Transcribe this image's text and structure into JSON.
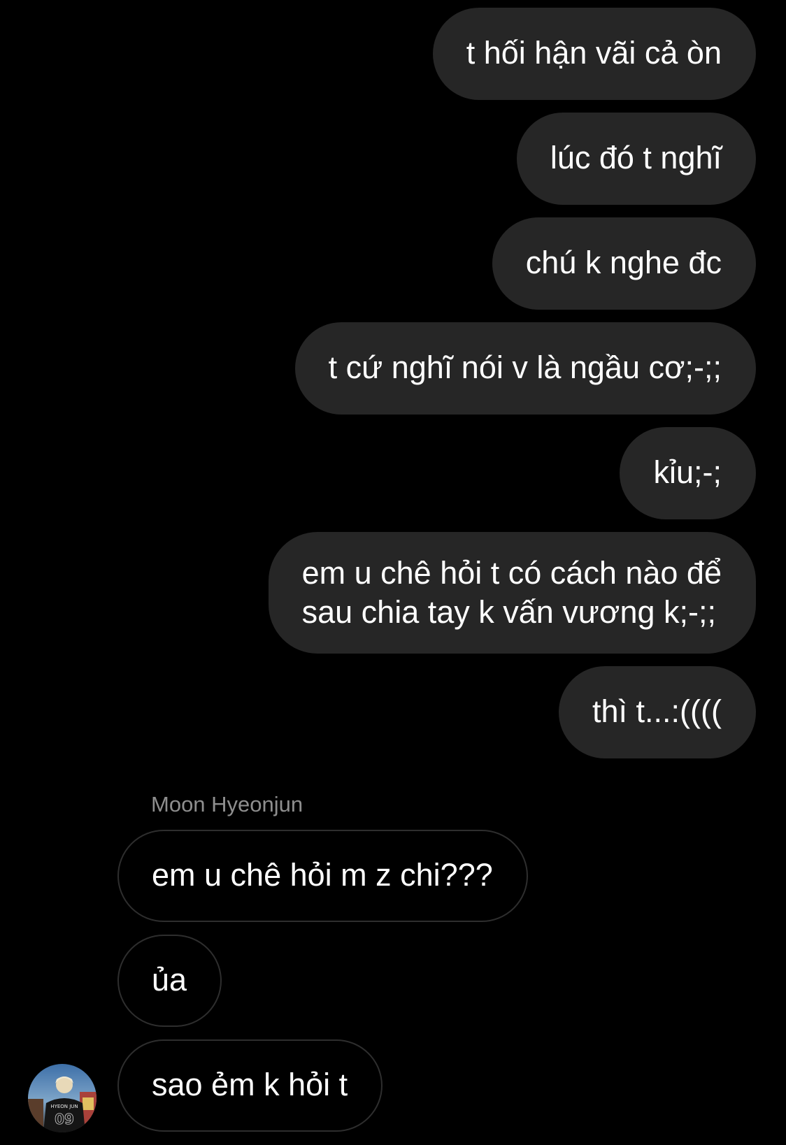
{
  "conversation": {
    "outgoing": [
      "t hối hận vãi cả òn",
      "lúc đó t nghĩ",
      "chú k nghe đc",
      "t cứ nghĩ nói v là ngầu cơ;-;;",
      "kỉu;-;",
      "em u chê hỏi t có cách nào để",
      "sau chia tay k vấn vương k;-;;",
      "thì t...:(((("
    ],
    "sender_name": "Moon Hyeonjun",
    "incoming": [
      "em u chê hỏi m z chi???",
      "ủa",
      "sao ẻm k hỏi t"
    ]
  },
  "avatar": {
    "jersey_text": "HYEON JUN",
    "jersey_number": "09"
  },
  "colors": {
    "background": "#000000",
    "outgoing_bubble": "#262626",
    "incoming_border": "#2e2e2e",
    "text": "#ffffff",
    "sender_name": "#8e8e8e"
  }
}
